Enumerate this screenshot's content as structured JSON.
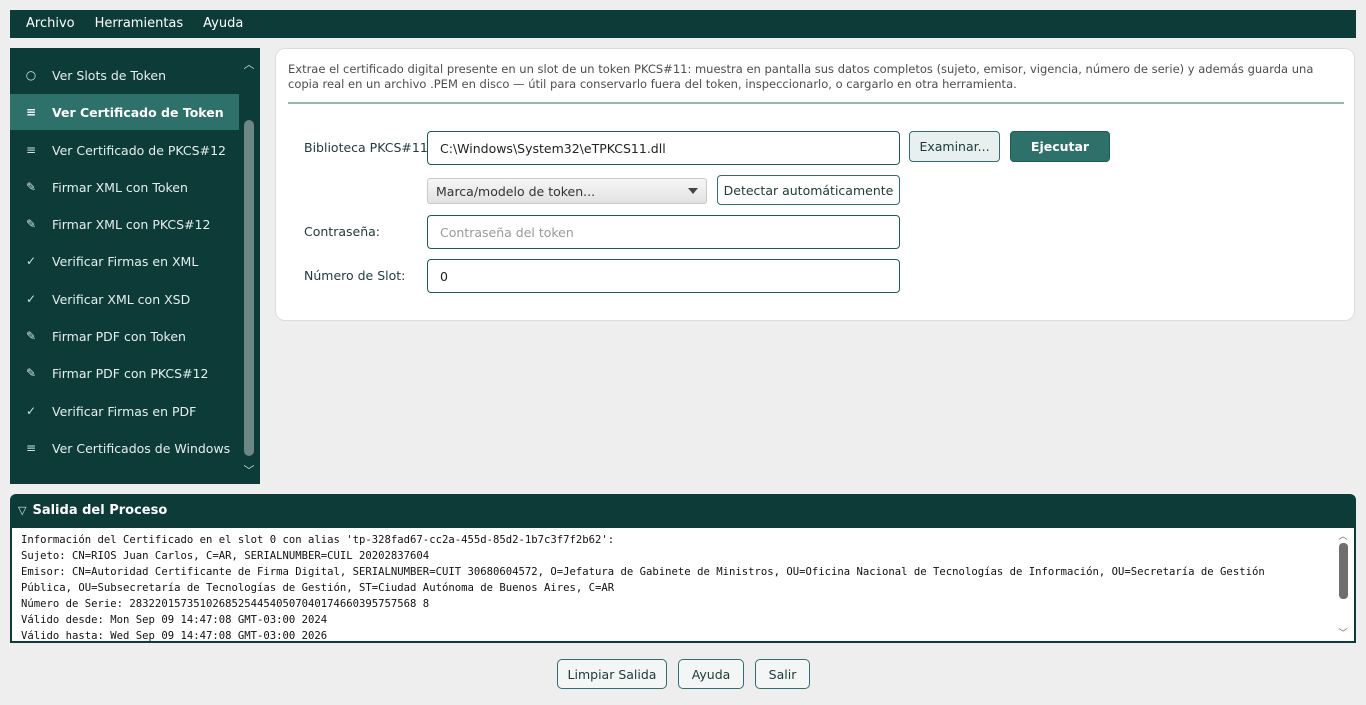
{
  "menubar": {
    "items": [
      "Archivo",
      "Herramientas",
      "Ayuda"
    ]
  },
  "sidebar": {
    "items": [
      {
        "icon": "○",
        "label": "Ver Slots de Token",
        "active": false
      },
      {
        "icon": "≡",
        "label": "Ver Certificado de Token",
        "active": true
      },
      {
        "icon": "≡",
        "label": "Ver Certificado de PKCS#12",
        "active": false
      },
      {
        "icon": "✎",
        "label": "Firmar XML con Token",
        "active": false
      },
      {
        "icon": "✎",
        "label": "Firmar XML con PKCS#12",
        "active": false
      },
      {
        "icon": "✓",
        "label": "Verificar Firmas en XML",
        "active": false
      },
      {
        "icon": "✓",
        "label": "Verificar XML con XSD",
        "active": false
      },
      {
        "icon": "✎",
        "label": "Firmar PDF con Token",
        "active": false
      },
      {
        "icon": "✎",
        "label": "Firmar PDF con PKCS#12",
        "active": false
      },
      {
        "icon": "✓",
        "label": "Verificar Firmas en PDF",
        "active": false
      },
      {
        "icon": "≡",
        "label": "Ver Certificados de Windows",
        "active": false
      }
    ]
  },
  "form": {
    "description": "Extrae el certificado digital presente en un slot de un token PKCS#11: muestra en pantalla sus datos completos (sujeto, emisor, vigencia, número de serie) y además guarda una copia real en un archivo .PEM en disco — útil para conservarlo fuera del token, inspeccionarlo, o cargarlo en otra herramienta.",
    "library_label": "Biblioteca PKCS#11:",
    "library_value": "C:\\Windows\\System32\\eTPKCS11.dll",
    "browse_button": "Examinar...",
    "run_button": "Ejecutar",
    "token_combo": "Marca/modelo de token...",
    "detect_button": "Detectar automáticamente",
    "password_label": "Contraseña:",
    "password_placeholder": "Contraseña del token",
    "slot_label": "Número de Slot:",
    "slot_value": "0"
  },
  "output": {
    "title": "Salida del Proceso",
    "text": "Información del Certificado en el slot 0 con alias 'tp-328fad67-cc2a-455d-85d2-1b7c3f7f2b62':\nSujeto: CN=RIOS Juan Carlos, C=AR, SERIALNUMBER=CUIL 20202837604\nEmisor: CN=Autoridad Certificante de Firma Digital, SERIALNUMBER=CUIT 30680604572, O=Jefatura de Gabinete de Ministros, OU=Oficina Nacional de Tecnologías de Información, OU=Secretaría de Gestión Pública, OU=Subsecretaría de Tecnologías de Gestión, ST=Ciudad Autónoma de Buenos Aires, C=AR\nNúmero de Serie: 283220157351026852544540507040174660395757568 8\nVálido desde: Mon Sep 09 14:47:08 GMT-03:00 2024\nVálido hasta: Wed Sep 09 14:47:08 GMT-03:00 2026"
  },
  "footer": {
    "clear_button": "Limpiar Salida",
    "help_button": "Ayuda",
    "exit_button": "Salir"
  }
}
